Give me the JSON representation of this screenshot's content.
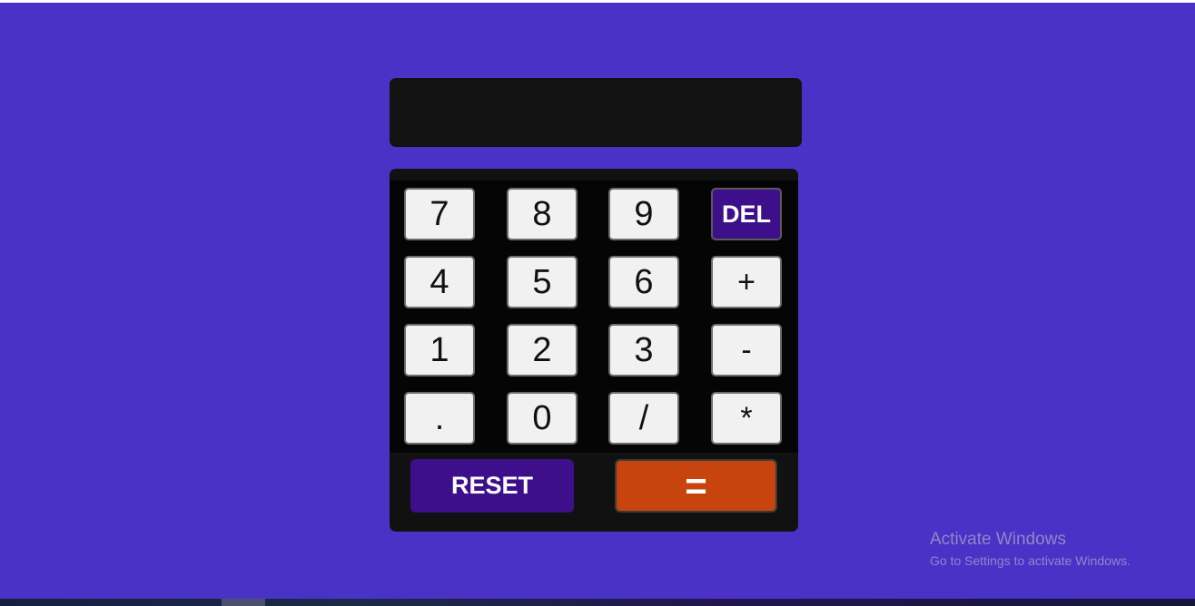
{
  "display": {
    "value": ""
  },
  "keypad": {
    "rows": [
      [
        "7",
        "8",
        "9",
        "DEL"
      ],
      [
        "4",
        "5",
        "6",
        "+"
      ],
      [
        "1",
        "2",
        "3",
        "-"
      ],
      [
        ".",
        "0",
        "/",
        "*"
      ]
    ],
    "reset_label": "RESET",
    "equals_label": "="
  },
  "colors": {
    "background": "#4a32c6",
    "display_bg": "#121212",
    "key_bg": "#f1f1f1",
    "accent_purple": "#3d0f8a",
    "equals_orange": "#c8440e"
  },
  "watermark": {
    "title": "Activate Windows",
    "subtitle": "Go to Settings to activate Windows."
  },
  "taskbar": {
    "clock": ""
  }
}
